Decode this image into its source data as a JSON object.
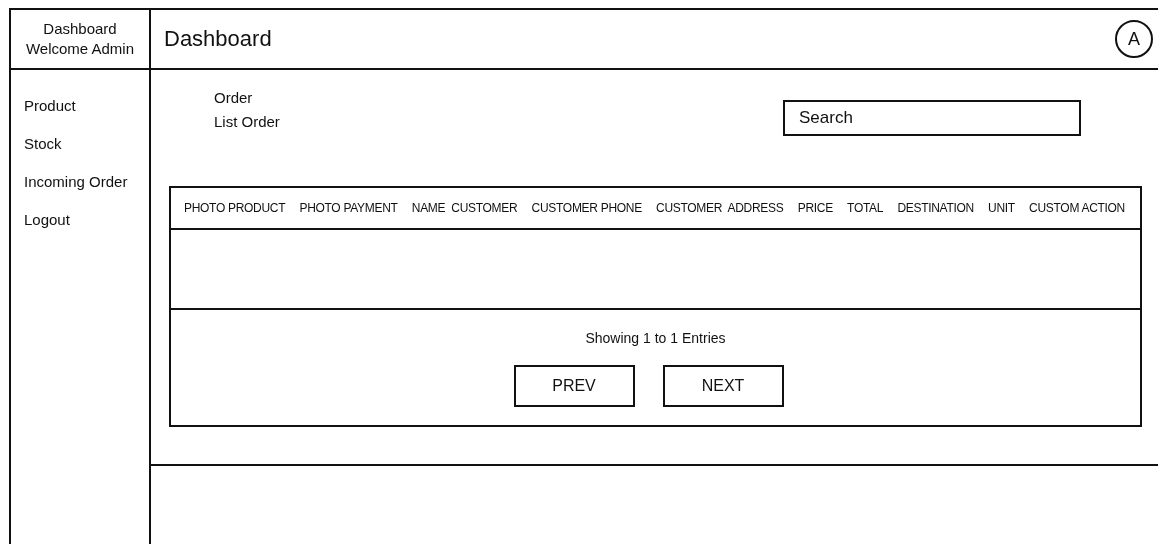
{
  "brand": {
    "title": "Dashboard",
    "subtitle": "Welcome Admin"
  },
  "header": {
    "title": "Dashboard",
    "avatar": "A"
  },
  "sidebar": {
    "items": [
      {
        "label": "Product"
      },
      {
        "label": "Stock"
      },
      {
        "label": "Incoming Order"
      },
      {
        "label": "Logout"
      }
    ]
  },
  "breadcrumb": {
    "section": "Order",
    "page": "List Order"
  },
  "search": {
    "placeholder": "Search"
  },
  "table": {
    "columns": [
      "PHOTO PRODUCT",
      "PHOTO PAYMENT",
      "NAME  CUSTOMER",
      "CUSTOMER PHONE",
      "CUSTOMER  ADDRESS",
      "PRICE",
      "TOTAL",
      "DESTINATION",
      "UNIT",
      "CUSTOM ACTION"
    ]
  },
  "pagination": {
    "info": "Showing 1 to 1 Entries",
    "buttons": [
      "PREV",
      "NEXT"
    ]
  }
}
